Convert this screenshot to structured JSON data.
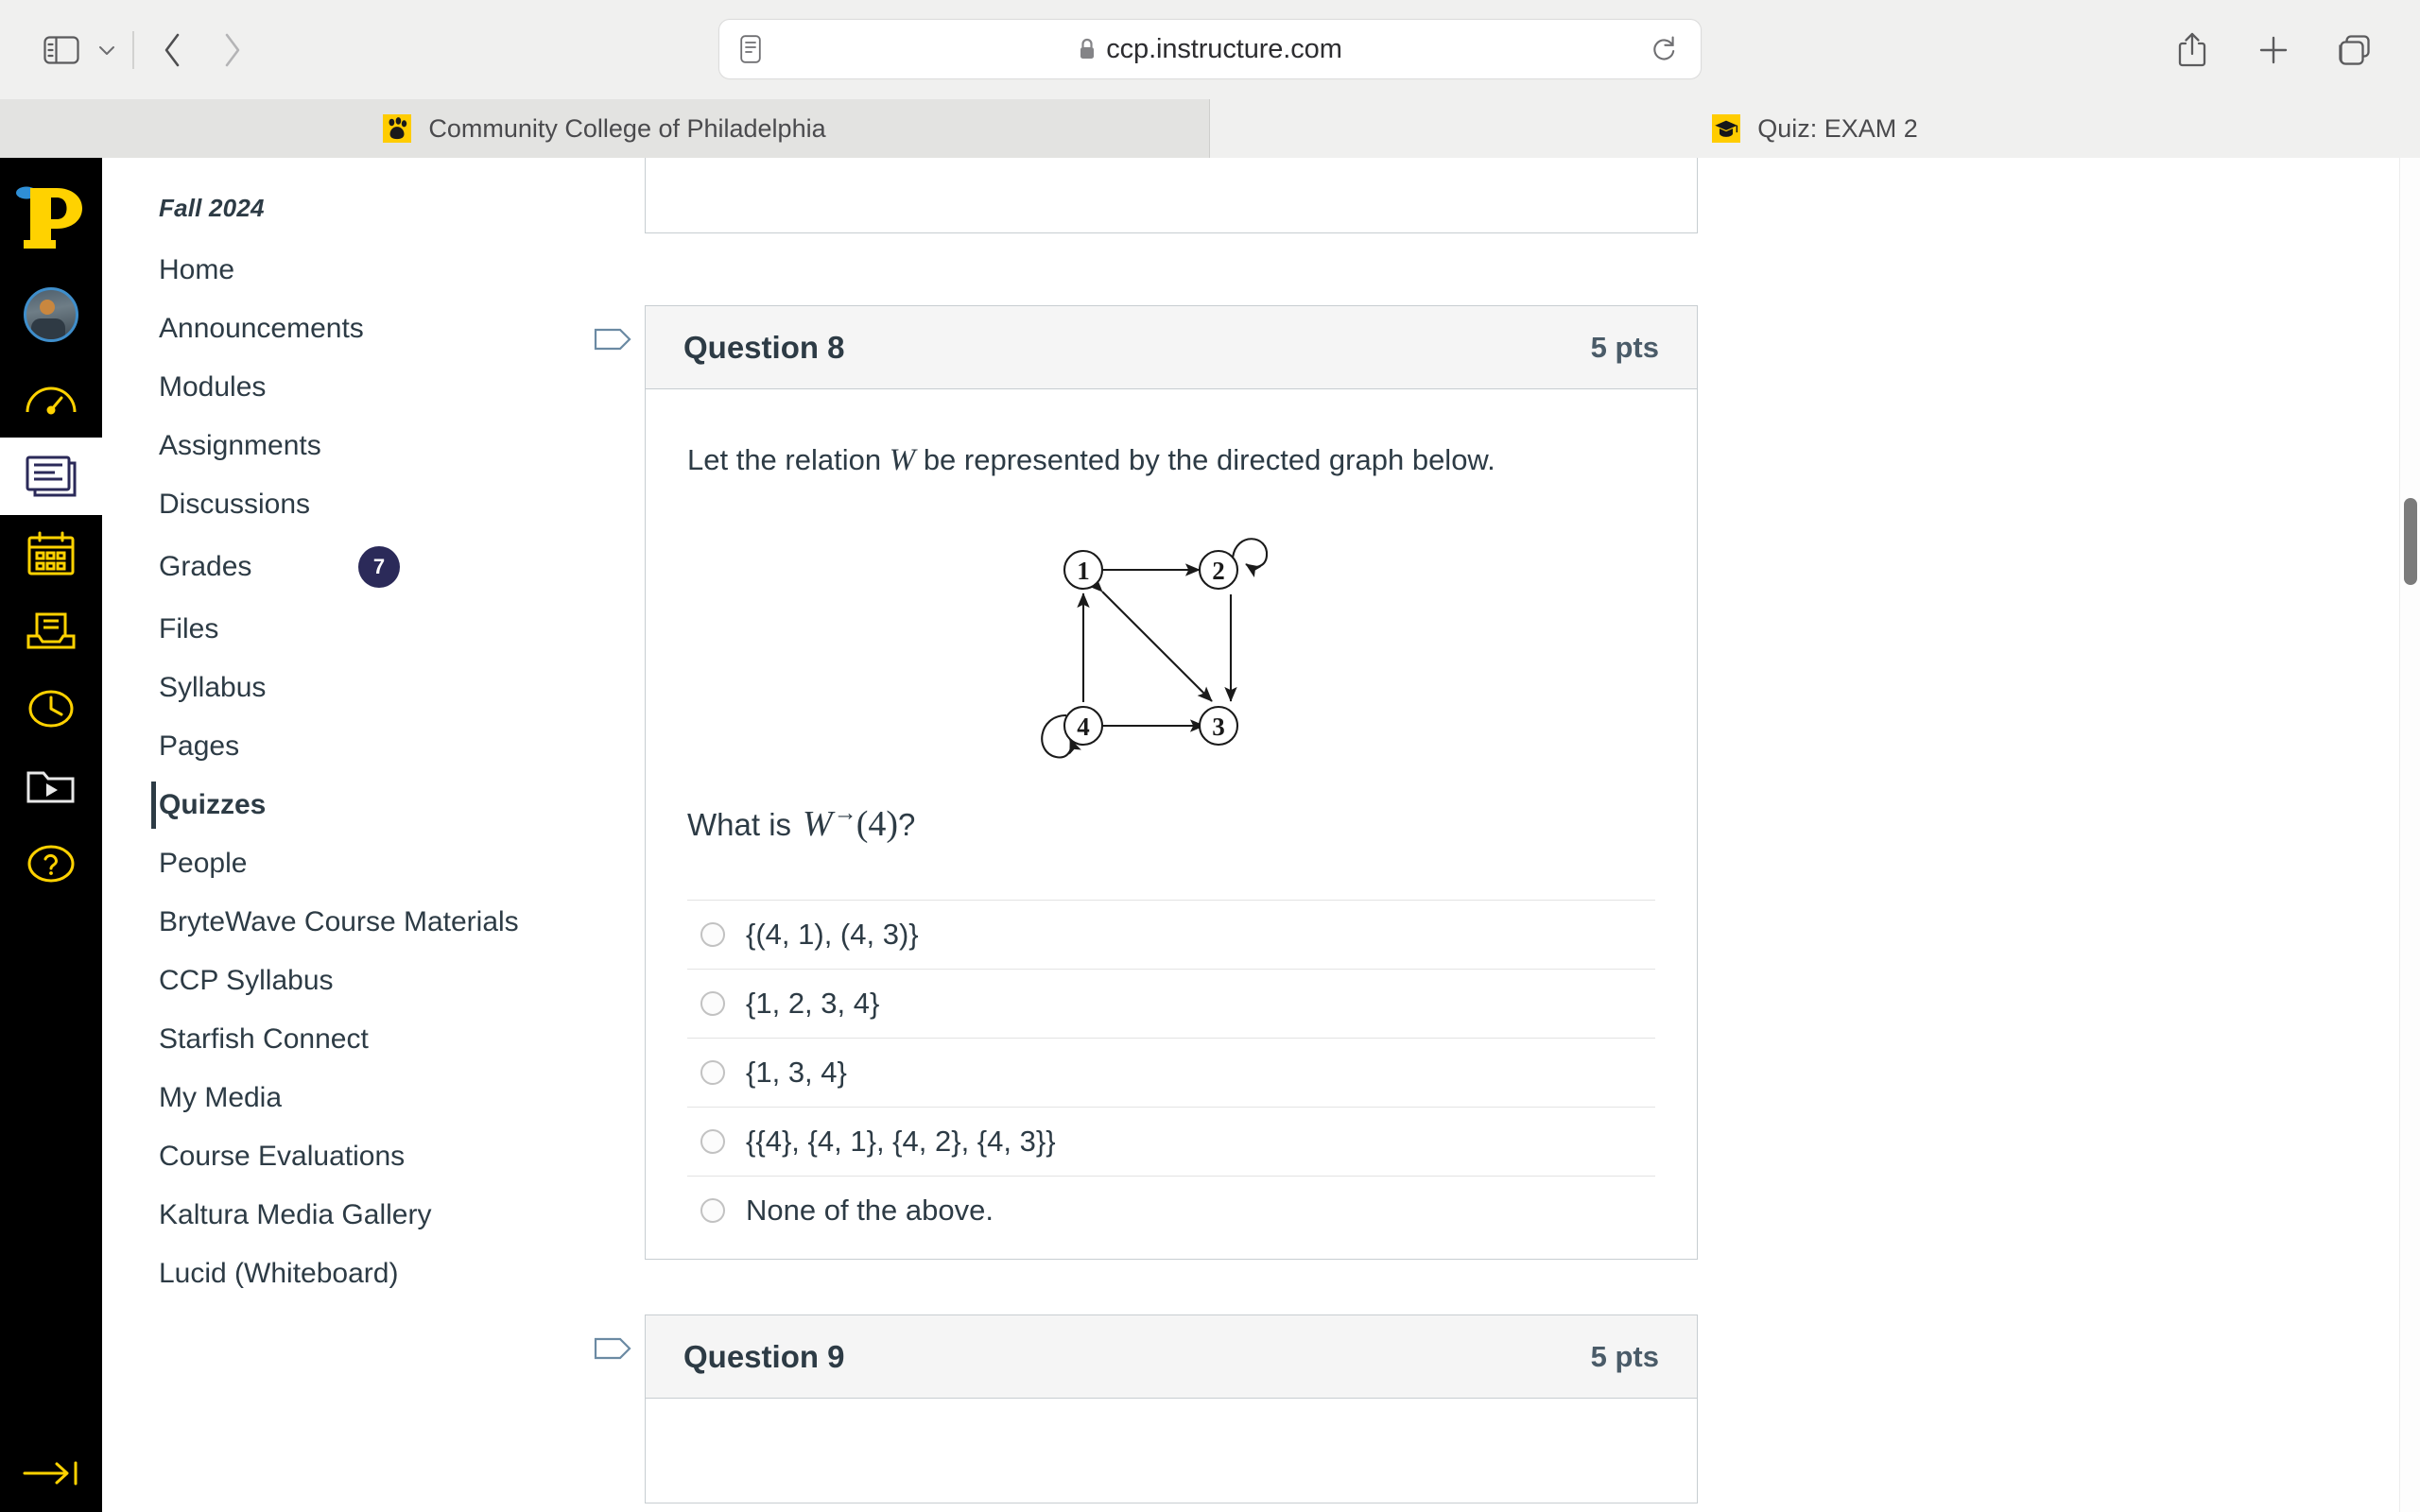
{
  "browser": {
    "url": "ccp.instructure.com",
    "url_icons": {
      "reader": "reader-icon",
      "lock": "lock-icon",
      "reload": "reload-icon"
    },
    "toolbar_icons": {
      "sidebar": "sidebar-toggle-icon",
      "sidebar_chevron": "chevron-down-icon",
      "back": "back-chevron-icon",
      "forward": "forward-chevron-icon",
      "share": "share-icon",
      "new_tab": "plus-icon",
      "tab_overview": "tab-overview-icon"
    },
    "tabs": [
      {
        "title": "Community College of Philadelphia",
        "favicon": "paw-print-icon",
        "active": true
      },
      {
        "title": "Quiz: EXAM 2",
        "favicon": "graduation-cap-icon",
        "active": false
      }
    ]
  },
  "global_nav": {
    "items": [
      {
        "name": "account-logo",
        "icon": "ccp-p-logo"
      },
      {
        "name": "account-avatar",
        "icon": "avatar"
      },
      {
        "name": "dashboard",
        "icon": "speedometer-icon"
      },
      {
        "name": "courses",
        "icon": "book-icon",
        "active": true
      },
      {
        "name": "calendar",
        "icon": "calendar-icon"
      },
      {
        "name": "inbox",
        "icon": "inbox-icon"
      },
      {
        "name": "history",
        "icon": "clock-icon"
      },
      {
        "name": "studio",
        "icon": "folder-play-icon"
      },
      {
        "name": "help",
        "icon": "question-circle-icon"
      }
    ],
    "collapse": {
      "name": "collapse-nav",
      "icon": "arrow-right-bar-icon"
    }
  },
  "course_nav": {
    "term": "Fall 2024",
    "items": [
      {
        "label": "Home",
        "active": false
      },
      {
        "label": "Announcements",
        "active": false
      },
      {
        "label": "Modules",
        "active": false
      },
      {
        "label": "Assignments",
        "active": false
      },
      {
        "label": "Discussions",
        "active": false
      },
      {
        "label": "Grades",
        "active": false,
        "badge": "7"
      },
      {
        "label": "Files",
        "active": false
      },
      {
        "label": "Syllabus",
        "active": false
      },
      {
        "label": "Pages",
        "active": false
      },
      {
        "label": "Quizzes",
        "active": true
      },
      {
        "label": "People",
        "active": false
      },
      {
        "label": "BryteWave Course Materials",
        "active": false
      },
      {
        "label": "CCP Syllabus",
        "active": false
      },
      {
        "label": "Starfish Connect",
        "active": false
      },
      {
        "label": "My Media",
        "active": false
      },
      {
        "label": "Course Evaluations",
        "active": false
      },
      {
        "label": "Kaltura Media Gallery",
        "active": false
      },
      {
        "label": "Lucid (Whiteboard)",
        "active": false
      }
    ]
  },
  "question8": {
    "title": "Question 8",
    "points": "5 pts",
    "stem_pre": "Let the relation ",
    "stem_var": "W",
    "stem_post": " be represented by the directed graph below.",
    "prompt_pre": "What is ",
    "prompt_math_base": "W",
    "prompt_math_sup": "→",
    "prompt_math_arg": "(4)",
    "prompt_post": "?",
    "graph": {
      "nodes": [
        "1",
        "2",
        "3",
        "4"
      ],
      "edges": [
        "1 → 2",
        "2 → 2",
        "2 → 3",
        "1 → 3",
        "3 → 1",
        "4 → 1",
        "4 → 3",
        "4 → 4"
      ]
    },
    "answers": [
      "{(4, 1), (4, 3)}",
      "{1, 2, 3, 4}",
      "{1, 3, 4}",
      "{{4}, {4, 1}, {4, 2}, {4, 3}}",
      "None of the above."
    ]
  },
  "question9": {
    "title": "Question 9",
    "points": "5 pts"
  }
}
